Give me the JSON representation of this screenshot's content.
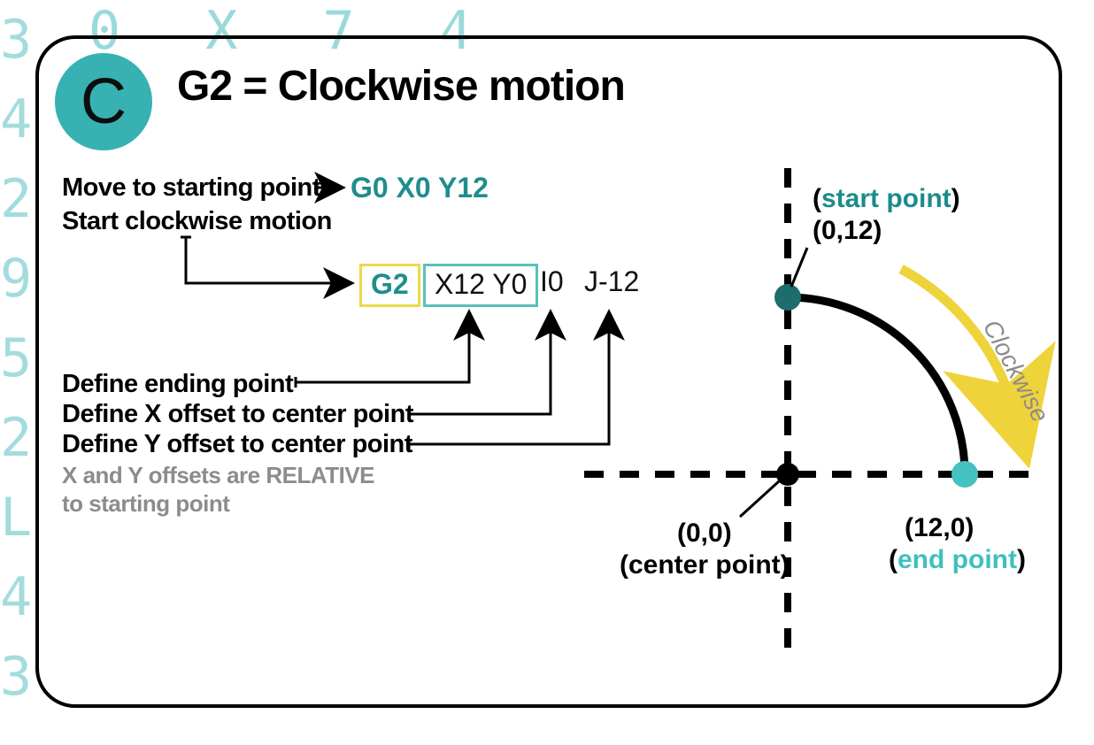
{
  "badge_letter": "C",
  "title": "G2 = Clockwise motion",
  "labels": {
    "move_start": "Move to starting point",
    "start_cw": "Start clockwise motion",
    "def_end": "Define ending point",
    "def_x": "Define X offset to center point",
    "def_y": "Define Y offset to center point",
    "note1": "X and Y offsets are RELATIVE",
    "note2": "to starting point"
  },
  "code": {
    "line1": "G0 X0 Y12",
    "g2": "G2",
    "xy": "X12 Y0",
    "i": "I0",
    "j": "J-12"
  },
  "diagram": {
    "start_label": "(start point)",
    "start_coord": "(0,12)",
    "end_coord": "(12,0)",
    "end_label": "(end point)",
    "center_coord": "(0,0)",
    "center_label": "(center point)",
    "arc_label": "Clockwise"
  },
  "bg_digits_side": "3\n4\n2\n9\n5\n2\nL\n4\n3",
  "bg_digits_top": "0 X   7 4"
}
